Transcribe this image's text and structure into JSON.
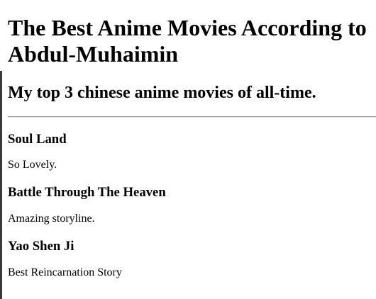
{
  "page": {
    "title": "The Best Anime Movies According to Abdul-Muhaimin",
    "subtitle": "My top 3 chinese anime movies of all-time."
  },
  "movies": [
    {
      "title": "Soul Land",
      "description": "So Lovely."
    },
    {
      "title": "Battle Through The Heaven",
      "description": "Amazing storyline."
    },
    {
      "title": "Yao Shen Ji",
      "description": "Best Reincarnation Story"
    }
  ],
  "colors": {
    "text": "#000000",
    "background": "#ffffff",
    "divider": "#9a9a9a",
    "left_edge": "#3a3a3a"
  }
}
